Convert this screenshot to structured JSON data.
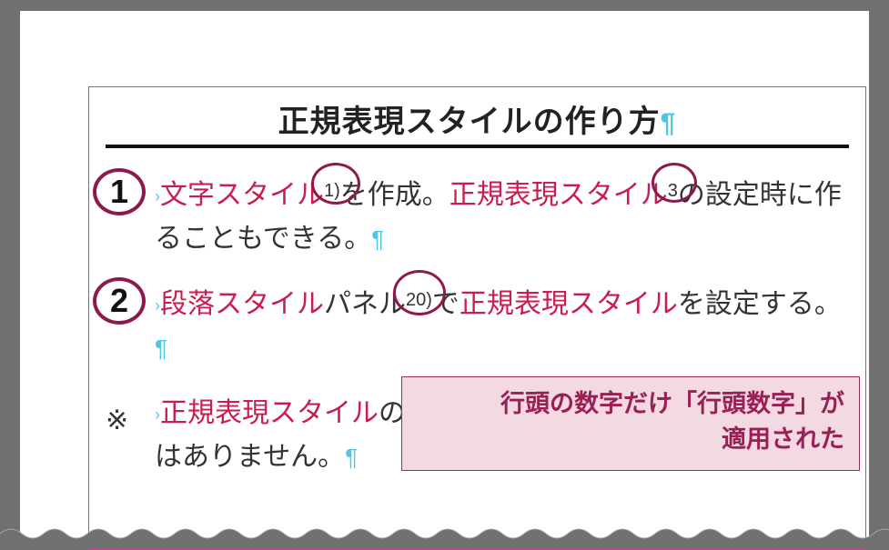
{
  "title": {
    "text": "正規表現スタイルの作り方",
    "pilcrow": "¶"
  },
  "marks": {
    "caret": "›",
    "pilcrow": "¶"
  },
  "steps": [
    {
      "lead": "1",
      "segments": {
        "s1": "文字スタイル",
        "sup1": "1)",
        "s2": "を作成。",
        "s3": "正規表現スタイル",
        "sup2": "3",
        "s4": "の設定時に作ることもできる。"
      }
    },
    {
      "lead": "2",
      "segments": {
        "s1": "段落スタイル",
        "s2": "パネル",
        "sup1": "20)",
        "s3": "で",
        "s4": "正規表現スタイル",
        "s5": "を設定する。"
      }
    }
  ],
  "note": {
    "bullet": "※",
    "s1": "正規表現スタイル",
    "s2": "の",
    "s3": "はありません。"
  },
  "callout": {
    "line1": "行頭の数字だけ「行頭数字」が",
    "line2": "適用された"
  }
}
